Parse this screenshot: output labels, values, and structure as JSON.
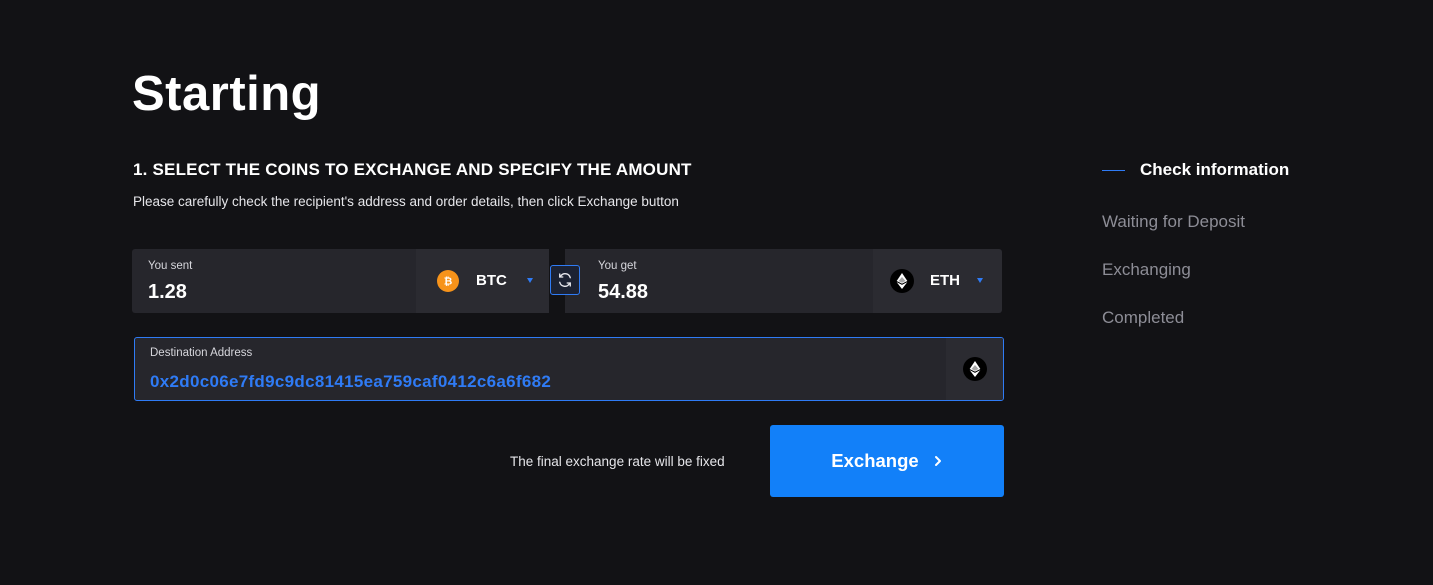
{
  "header": {
    "title": "Starting"
  },
  "section": {
    "heading": "1. SELECT THE COINS TO EXCHANGE AND SPECIFY THE AMOUNT",
    "description": "Please carefully check the recipient's address and order details, then click Exchange button"
  },
  "send": {
    "label": "You sent",
    "amount": "1.28",
    "coin": "BTC",
    "coin_icon": "bitcoin-icon"
  },
  "receive": {
    "label": "You get",
    "amount": "54.88",
    "coin": "ETH",
    "coin_icon": "ethereum-icon"
  },
  "destination": {
    "label": "Destination Address",
    "address": "0x2d0c06e7fd9c9dc81415ea759caf0412c6a6f682",
    "coin_icon": "ethereum-icon"
  },
  "footer": {
    "rate_note": "The final exchange rate will be fixed",
    "exchange_label": "Exchange"
  },
  "steps": [
    {
      "label": "Check information",
      "active": true
    },
    {
      "label": "Waiting for Deposit",
      "active": false
    },
    {
      "label": "Exchanging",
      "active": false
    },
    {
      "label": "Completed",
      "active": false
    }
  ],
  "colors": {
    "background": "#121215",
    "accent": "#2f7bf5",
    "button": "#1280f9",
    "bitcoin": "#f7931a"
  }
}
